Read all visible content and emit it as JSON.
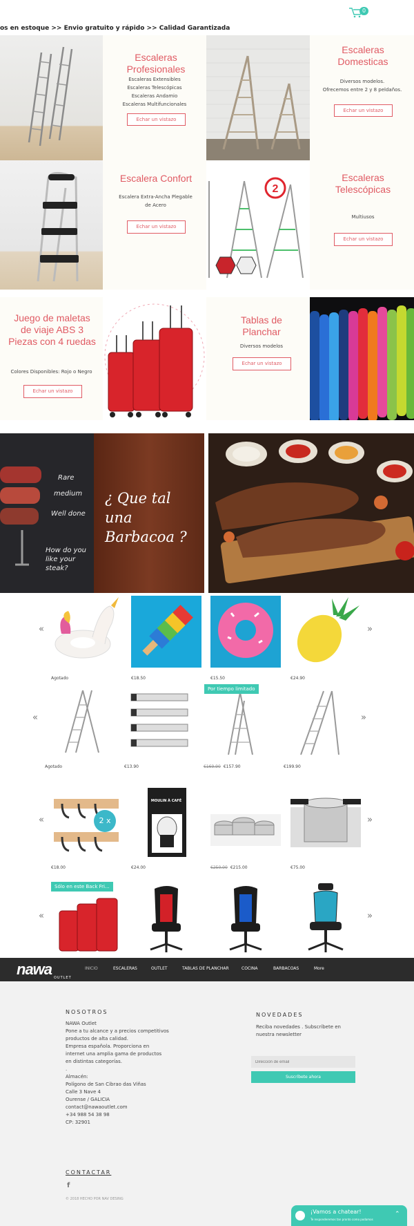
{
  "header": {
    "cart_count": "0",
    "marquee": "os en estoque  >> Envio gratuito y rápido  >> Calidad Garantizada"
  },
  "cards": {
    "profesionales": {
      "title": "Escaleras Profesionales",
      "lines": [
        "Escaleras Extensibles",
        "Escaleras Telescópicas",
        "Escaleras Andamio",
        "Escaleras Multifuncionales"
      ],
      "button": "Echar un vistazo"
    },
    "domesticas": {
      "title": "Escaleras Domesticas",
      "lines": [
        "Diversos modelos.",
        "Ofrecemos entre 2 y 8 peldaños."
      ],
      "button": "Echar un vistazo"
    },
    "confort": {
      "title": "Escalera Confort",
      "lines": [
        "Escalera Extra-Ancha Plegable de Acero"
      ],
      "button": "Echar un vistazo"
    },
    "telescopicas": {
      "title": "Escaleras Telescópicas",
      "lines": [
        "Multiusos"
      ],
      "button": "Echar un vistazo"
    },
    "maletas": {
      "title": "Juego de maletas de viaje ABS 3 Piezas con 4 ruedas",
      "lines": [
        "Colores Disponibles: Rojo o Negro"
      ],
      "button": "Echar un vistazo"
    },
    "planchar": {
      "title": "Tablas de Planchar",
      "lines": [
        "Diversos modelos"
      ],
      "button": "Echar un vistazo"
    }
  },
  "barbacoa": {
    "text": "¿ Que tal una Barbacoa ?",
    "steak_labels": [
      "Rare",
      "medium",
      "Well done"
    ],
    "steak_question": "How do you like your steak?"
  },
  "sliders": {
    "row1": [
      "Agotado",
      "€18.50",
      "€15.50",
      "€24.90"
    ],
    "row2": [
      "Agotado",
      "€13.90",
      "€157.90",
      "€199.90"
    ],
    "row2_old": "€169.90",
    "row2_badge": "Por tiempo limitado",
    "row3": [
      "€18.00",
      "€24.00",
      "€215.00",
      "€75.00"
    ],
    "row3_old": "€250.00",
    "row3_hooks_badge": "2 x",
    "row3_coffee_label": "MOULIN À CAFÉ",
    "row4_badge": "Sólo en este Back Fri..."
  },
  "nav": {
    "logo": "nawa",
    "logo_sub": "OUTLET",
    "items": [
      "INICIO",
      "ESCALERAS",
      "OUTLET",
      "TABLAS DE PLANCHAR",
      "COCINA",
      "BARBACOAS",
      "More"
    ]
  },
  "footer": {
    "nosotros_title": "NOSOTROS",
    "nosotros_lines": [
      "NAWA Outlet",
      "Pone a tu alcance y a precios competitivos",
      "productos de alta calidad.",
      "Empresa española. Proporciona en",
      "internet una amplia gama de productos",
      "en distintas categorías.",
      ".",
      "Almacén:",
      "Polígono de San Cibrao das Viñas",
      "Calle 3  Nave 4",
      "Ourense  / GALICIA",
      "contact@nawaoutlet.com",
      "+34 988 54 38 98",
      "CP: 32901"
    ],
    "novedades_title": "NOVEDADES",
    "novedades_text": [
      "Reciba novedades . Subscríbete en",
      "nuestra newsletter"
    ],
    "email_placeholder": "Dirección de email",
    "subscribe": "Suscríbete ahora",
    "contactar": "CONTACTAR",
    "facebook": "f",
    "copyright": "© 2018 HECHO POR NAV DESING",
    "chat_title": "¡Vamos a chatear!",
    "chat_sub": "Te responderemos tan pronto como podamos"
  }
}
